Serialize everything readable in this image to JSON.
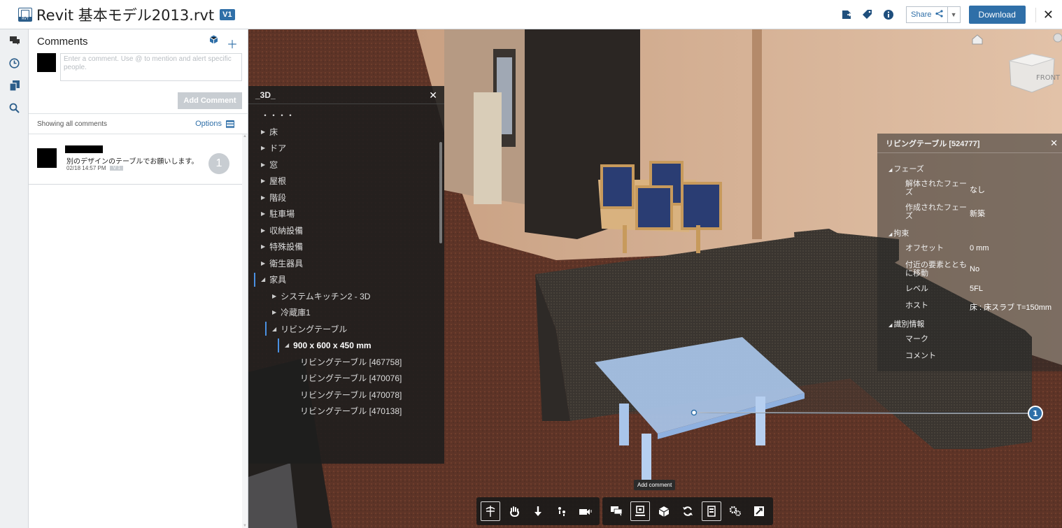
{
  "header": {
    "app_icon": "revit-file-icon",
    "app_icon_text": "RVT",
    "title": "Revit 基本モデル2013.rvt",
    "version_badge": "V1",
    "share_label": "Share",
    "download_label": "Download",
    "icons": [
      "export-icon",
      "tag-icon",
      "info-icon",
      "share-icon",
      "chevron-down-icon",
      "close-icon"
    ]
  },
  "rail": {
    "items": [
      {
        "name": "comments-tab",
        "icon": "comment-icon",
        "glyph": "▬"
      },
      {
        "name": "history-tab",
        "icon": "clock-icon",
        "glyph": "◷"
      },
      {
        "name": "versions-tab",
        "icon": "copy-icon",
        "glyph": "❐"
      },
      {
        "name": "search-tab",
        "icon": "search-icon",
        "glyph": "⚲"
      }
    ]
  },
  "comments": {
    "title": "Comments",
    "input_placeholder": "Enter a comment. Use @ to mention and alert specific people.",
    "add_button": "Add Comment",
    "filter_text": "Showing all comments",
    "options_label": "Options",
    "items": [
      {
        "text": "別のデザインのテーブルでお願いします。",
        "date": "02/18 14:57 PM",
        "version": "V 1",
        "count": "1"
      }
    ]
  },
  "browser": {
    "title": "_3D_",
    "items": [
      {
        "label": "・・・・",
        "level": 1,
        "arrow": "",
        "bold": false
      },
      {
        "label": "床",
        "level": 1,
        "arrow": "▶",
        "bold": false
      },
      {
        "label": "ドア",
        "level": 1,
        "arrow": "▶",
        "bold": false
      },
      {
        "label": "窓",
        "level": 1,
        "arrow": "▶",
        "bold": false
      },
      {
        "label": "屋根",
        "level": 1,
        "arrow": "▶",
        "bold": false
      },
      {
        "label": "階段",
        "level": 1,
        "arrow": "▶",
        "bold": false
      },
      {
        "label": "駐車場",
        "level": 1,
        "arrow": "▶",
        "bold": false
      },
      {
        "label": "収納設備",
        "level": 1,
        "arrow": "▶",
        "bold": false
      },
      {
        "label": "特殊設備",
        "level": 1,
        "arrow": "▶",
        "bold": false
      },
      {
        "label": "衛生器具",
        "level": 1,
        "arrow": "▶",
        "bold": false
      },
      {
        "label": "家具",
        "level": 1,
        "arrow": "◢",
        "bold": false,
        "marked": true
      },
      {
        "label": "システムキッチン2 - 3D",
        "level": 2,
        "arrow": "▶",
        "bold": false
      },
      {
        "label": "冷蔵庫1",
        "level": 2,
        "arrow": "▶",
        "bold": false
      },
      {
        "label": "リビングテーブル",
        "level": 2,
        "arrow": "◢",
        "bold": false,
        "marked": true
      },
      {
        "label": "900 x 600 x 450 mm",
        "level": 3,
        "arrow": "◢",
        "bold": true,
        "marked": true
      },
      {
        "label": "リビングテーブル [467758]",
        "level": 4,
        "arrow": "",
        "bold": false
      },
      {
        "label": "リビングテーブル [470076]",
        "level": 4,
        "arrow": "",
        "bold": false
      },
      {
        "label": "リビングテーブル [470078]",
        "level": 4,
        "arrow": "",
        "bold": false
      },
      {
        "label": "リビングテーブル [470138]",
        "level": 4,
        "arrow": "",
        "bold": false
      }
    ]
  },
  "properties": {
    "title": "リビングテーブル [524777]",
    "rows": [
      {
        "type": "cat",
        "label": "フェーズ"
      },
      {
        "type": "kv",
        "label": "解体されたフェーズ",
        "value": "なし"
      },
      {
        "type": "kv",
        "label": "作成されたフェーズ",
        "value": "新築"
      },
      {
        "type": "cat",
        "label": "拘束"
      },
      {
        "type": "kv",
        "label": "オフセット",
        "value": "0 mm"
      },
      {
        "type": "kv",
        "label": "付近の要素とともに移動",
        "value": "No"
      },
      {
        "type": "kv",
        "label": "レベル",
        "value": "5FL"
      },
      {
        "type": "kv",
        "label": "ホスト",
        "value": "床 : 床スラブ  T=150mm"
      },
      {
        "type": "cat",
        "label": "識別情報"
      },
      {
        "type": "kv",
        "label": "マーク",
        "value": ""
      },
      {
        "type": "kv",
        "label": "コメント",
        "value": ""
      }
    ]
  },
  "viewcube": {
    "face_label": "FRONT"
  },
  "markup": {
    "pin_number": "1"
  },
  "toolbar": {
    "tooltip": "Add comment",
    "group1": [
      "orbit-icon",
      "pan-icon",
      "zoom-icon",
      "walk-icon",
      "camera-icon"
    ],
    "group2": [
      "comment-icon",
      "markup-icon",
      "explode-icon",
      "reset-icon",
      "model-browser-icon",
      "settings-icon",
      "fullscreen-icon"
    ]
  }
}
